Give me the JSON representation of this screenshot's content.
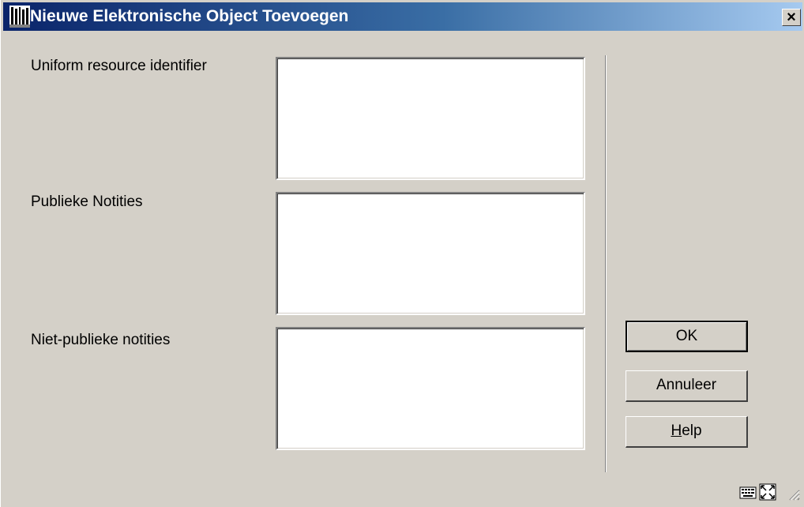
{
  "window": {
    "title": "Nieuwe Elektronische Object Toevoegen",
    "close_symbol": "×",
    "app_icon": "library-books-icon"
  },
  "fields": [
    {
      "label": "Uniform resource identifier",
      "value": ""
    },
    {
      "label": "Publieke Notities",
      "value": ""
    },
    {
      "label": "Niet-publieke notities",
      "value": ""
    }
  ],
  "buttons": {
    "ok": "OK",
    "cancel": "Annuleer",
    "help_prefix": "H",
    "help_rest": "elp"
  },
  "status_icons": [
    "keyboard-icon",
    "resize-icon",
    "size-grip-icon"
  ],
  "colors": {
    "title_start": "#0a246a",
    "title_end": "#a6caf0",
    "face": "#d4d0c8"
  }
}
